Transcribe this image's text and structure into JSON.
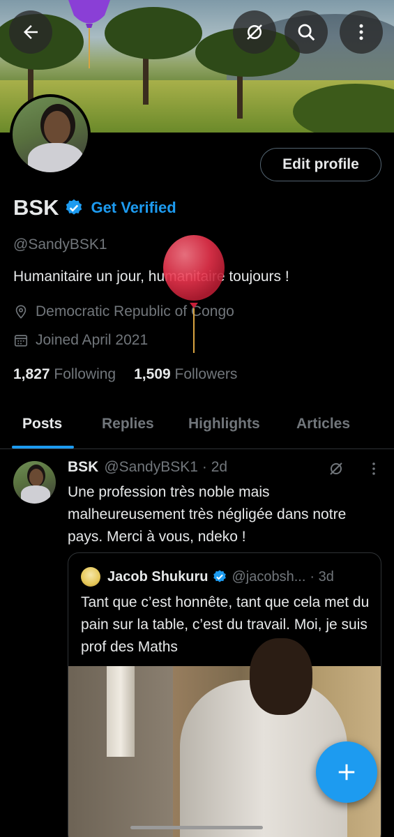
{
  "header": {
    "back_icon": "arrow-left-icon",
    "grok_icon": "grok-icon",
    "search_icon": "search-icon",
    "more_icon": "more-vertical-icon"
  },
  "profile": {
    "name": "BSK",
    "get_verified_label": "Get Verified",
    "handle": "@SandyBSK1",
    "bio": "Humanitaire un jour, humanitaire toujours !",
    "location": "Democratic Republic of Congo",
    "joined": "Joined April 2021",
    "following_count": "1,827",
    "following_label": "Following",
    "followers_count": "1,509",
    "followers_label": "Followers",
    "edit_profile_label": "Edit profile"
  },
  "tabs": [
    "Posts",
    "Replies",
    "Highlights",
    "Articles"
  ],
  "active_tab": "Posts",
  "post": {
    "author_name": "BSK",
    "author_handle": "@SandyBSK1",
    "time": "· 2d",
    "text": "Une profession très noble mais malheureusement très négligée dans notre pays.  Merci à vous, ndeko !",
    "quote": {
      "author_name": "Jacob Shukuru",
      "author_handle": "@jacobsh...",
      "time": "· 3d",
      "text": "Tant que c’est honnête, tant que cela met du pain sur la table, c’est du travail. Moi, je suis prof des Maths"
    }
  },
  "colors": {
    "accent": "#1d9bf0",
    "background": "#000000",
    "text_primary": "#e7e9ea",
    "text_secondary": "#71767b"
  }
}
